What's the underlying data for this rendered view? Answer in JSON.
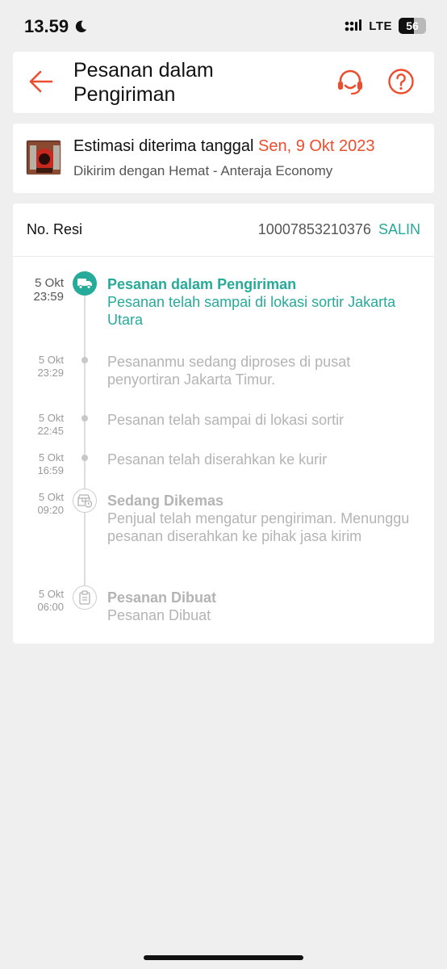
{
  "status_bar": {
    "time": "13.59",
    "network": "LTE",
    "battery": "56",
    "battery_level": 0.56,
    "icons": [
      "moon-icon",
      "signal-icon"
    ]
  },
  "header": {
    "title": "Pesanan dalam Pengiriman",
    "icons": [
      "back-arrow-icon",
      "headset-support-icon",
      "help-question-icon"
    ]
  },
  "estimate": {
    "label": "Estimasi diterima tanggal",
    "date": "Sen, 9 Okt 2023",
    "shipping": "Dikirim dengan Hemat - Anteraja Economy"
  },
  "tracking": {
    "resi_label": "No. Resi",
    "resi_number": "10007853210376",
    "copy_label": "SALIN",
    "events": [
      {
        "date": "5 Okt",
        "time": "23:59",
        "title": "Pesanan dalam Pengiriman",
        "description": "Pesanan telah sampai di lokasi sortir Jakarta Utara",
        "icon": "truck-icon",
        "active": true
      },
      {
        "date": "5 Okt",
        "time": "23:29",
        "title": "",
        "description": "Pesananmu sedang diproses di pusat penyortiran Jakarta Timur.",
        "icon": "dot",
        "active": false
      },
      {
        "date": "5 Okt",
        "time": "22:45",
        "title": "",
        "description": "Pesanan telah sampai di lokasi sortir",
        "icon": "dot",
        "active": false
      },
      {
        "date": "5 Okt",
        "time": "16:59",
        "title": "",
        "description": "Pesanan telah diserahkan ke kurir",
        "icon": "dot",
        "active": false
      },
      {
        "date": "5 Okt",
        "time": "09:20",
        "title": "Sedang Dikemas",
        "description": "Penjual telah mengatur pengiriman. Menunggu pesanan diserahkan ke pihak jasa kirim",
        "icon": "package-clock-icon",
        "active": false
      },
      {
        "date": "5 Okt",
        "time": "06:00",
        "title": "Pesanan Dibuat",
        "description": "Pesanan Dibuat",
        "icon": "clipboard-icon",
        "active": false
      }
    ]
  },
  "colors": {
    "accent_orange": "#ee4d2d",
    "accent_teal": "#26aa99",
    "muted": "#b4b4b4",
    "background": "#efefef"
  }
}
